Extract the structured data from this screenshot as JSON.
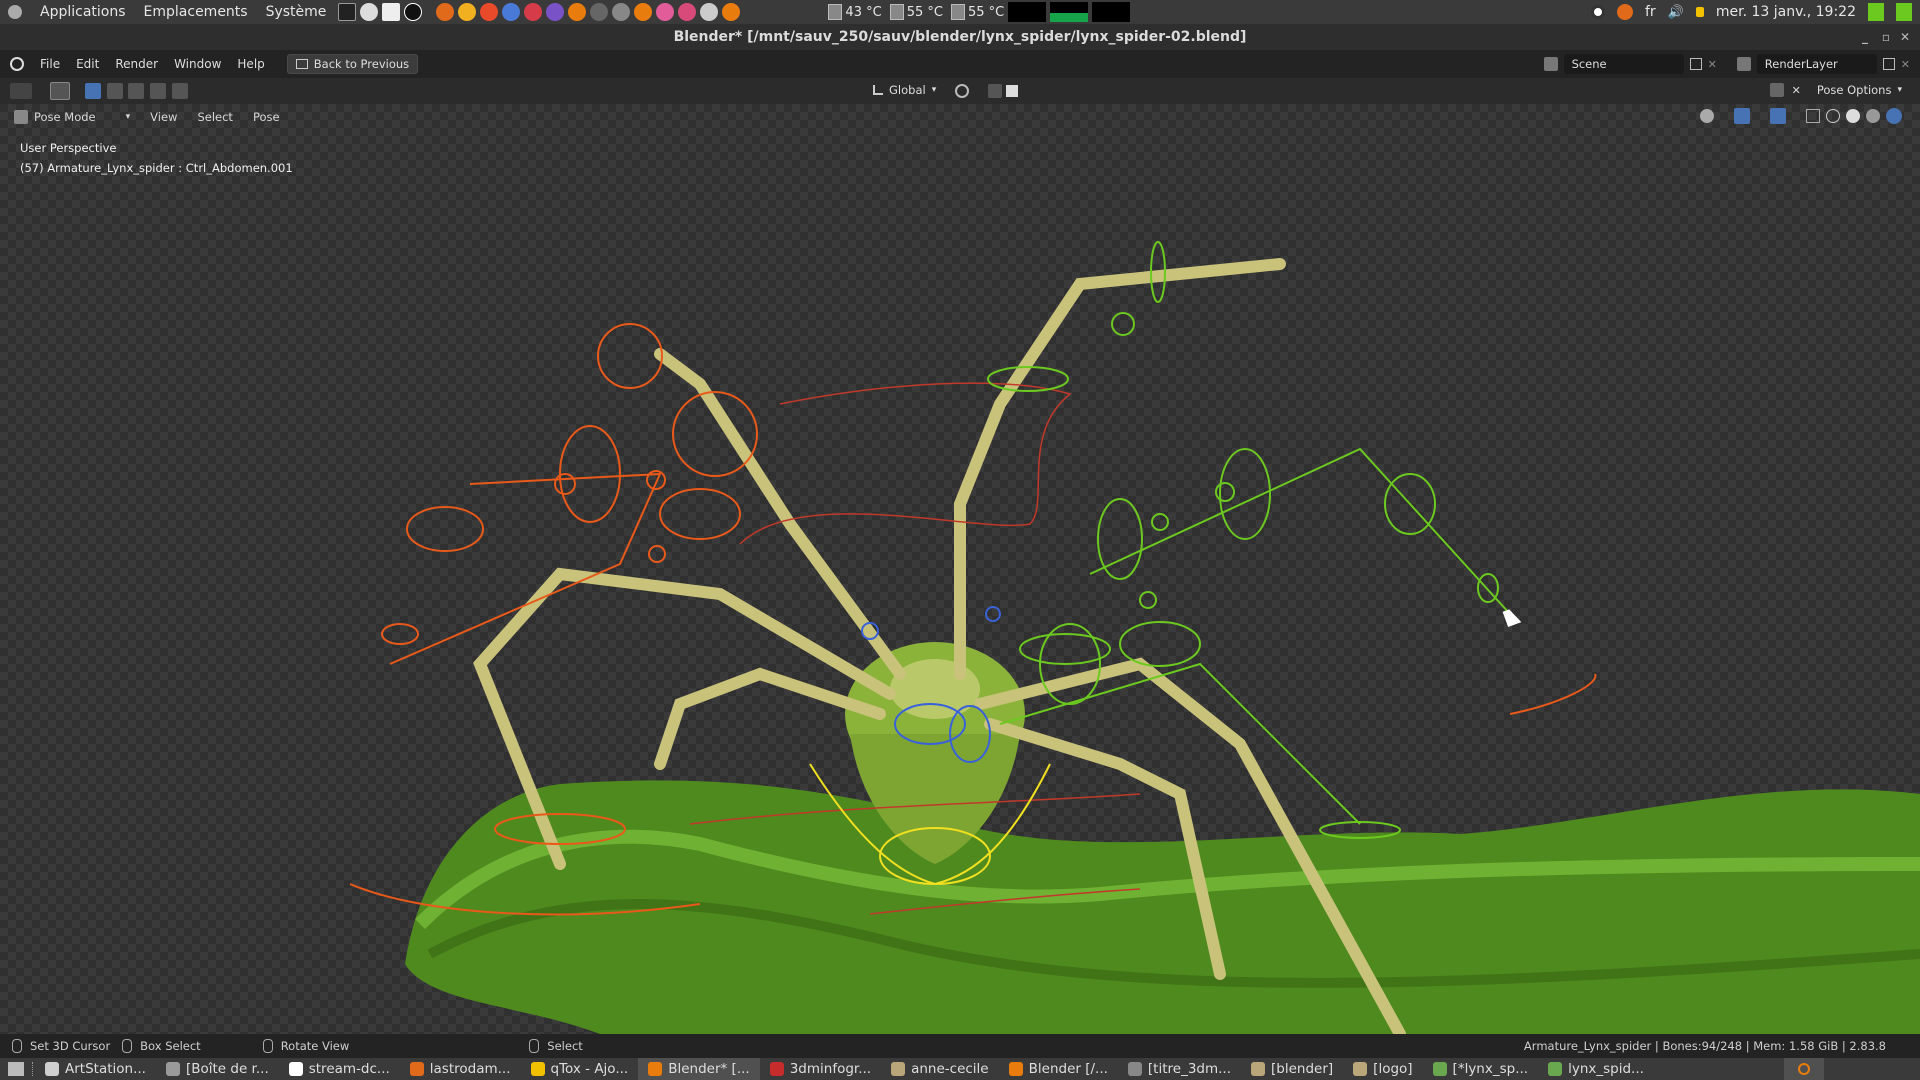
{
  "top_panel": {
    "menus": [
      "Applications",
      "Emplacements",
      "Système"
    ],
    "temps": [
      "43 °C",
      "55 °C",
      "55 °C"
    ],
    "keyboard_layout": "fr",
    "datetime": "mer. 13 janv., 19:22"
  },
  "window": {
    "title": "Blender* [/mnt/sauv_250/sauv/blender/lynx_spider/lynx_spider-02.blend]"
  },
  "blender_menu": {
    "items": [
      "File",
      "Edit",
      "Render",
      "Window",
      "Help"
    ],
    "back_button": "Back to Previous",
    "scene_field": "Scene",
    "render_layer_field": "RenderLayer"
  },
  "header": {
    "transform_orientation": "Global",
    "pose_options": "Pose Options"
  },
  "mode_row": {
    "mode": "Pose Mode",
    "menus": [
      "View",
      "Select",
      "Pose"
    ]
  },
  "viewport": {
    "perspective": "User Perspective",
    "active_object": "(57) Armature_Lynx_spider : Ctrl_Abdomen.001"
  },
  "status_bar": {
    "hints": [
      "Set 3D Cursor",
      "Box Select",
      "Rotate View",
      "Select"
    ],
    "stats": "Armature_Lynx_spider | Bones:94/248 | Mem: 1.58 GiB | 2.83.8"
  },
  "taskbar": {
    "tasks": [
      {
        "label": "ArtStation...",
        "icon_color": "#cfcfcf"
      },
      {
        "label": "[Boîte de r...",
        "icon_color": "#9a9a9a"
      },
      {
        "label": "stream-dc...",
        "icon_color": "#ffffff"
      },
      {
        "label": "lastrodam...",
        "icon_color": "#e06a1a"
      },
      {
        "label": "qTox - Ajo...",
        "icon_color": "#f2c200"
      },
      {
        "label": "Blender* [...",
        "icon_color": "#e87d0d",
        "active": true
      },
      {
        "label": "3dminfogr...",
        "icon_color": "#c72c2c"
      },
      {
        "label": "anne-cecile",
        "icon_color": "#b9a77a"
      },
      {
        "label": "Blender [/...",
        "icon_color": "#e87d0d"
      },
      {
        "label": "[titre_3dm...",
        "icon_color": "#888888"
      },
      {
        "label": "[blender]",
        "icon_color": "#b9a77a"
      },
      {
        "label": "[logo]",
        "icon_color": "#b9a77a"
      },
      {
        "label": "[*lynx_sp...",
        "icon_color": "#6aa84f"
      },
      {
        "label": "lynx_spid...",
        "icon_color": "#6aa84f"
      }
    ]
  },
  "colors": {
    "accent_orange": "#e87d0d",
    "bone_orange": "#e8591a",
    "bone_green": "#6cc91f",
    "bone_blue": "#3a62d8",
    "selection_yellow": "#f0e020"
  }
}
